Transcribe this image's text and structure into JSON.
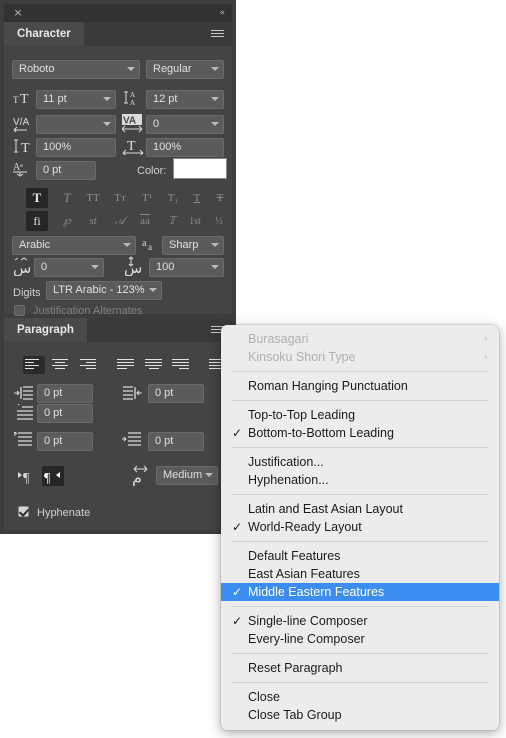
{
  "panel": {
    "close_icon": "×",
    "collapse_icon": "«",
    "character": {
      "tab_label": "Character",
      "menu_icon": "hamburger-icon",
      "font_family": "Roboto",
      "font_style": "Regular",
      "font_size_icon": "T",
      "font_size": "11 pt",
      "leading_icon": "leading-icon",
      "leading": "12 pt",
      "kerning_icon": "V/A",
      "kerning": "",
      "tracking_icon": "VA",
      "tracking": "0",
      "vertical_scale_icon": "vertical-scale-icon",
      "vertical_scale": "100%",
      "horizontal_scale_icon": "horizontal-scale-icon",
      "horizontal_scale": "100%",
      "baseline_shift_icon": "baseline-shift-icon",
      "baseline_shift": "0 pt",
      "color_label": "Color:",
      "color_value": "#ffffff",
      "style_buttons": [
        "T",
        "T",
        "TT",
        "Tт",
        "T¹",
        "T₁",
        "T",
        "T"
      ],
      "style_buttons_names": [
        "faux-bold",
        "faux-italic",
        "all-caps",
        "small-caps",
        "superscript",
        "subscript",
        "underline",
        "strikethrough"
      ],
      "opentype_buttons": [
        "fi",
        "℘",
        "st",
        "𝒜",
        "aa",
        "𝕋",
        "1st",
        "½"
      ],
      "opentype_names": [
        "standard-ligatures",
        "discretionary-ligatures",
        "swash",
        "stylistic-alternates",
        "titling-alternates",
        "ordinals",
        "fractions-1st",
        "fractions-half"
      ],
      "language": "Arabic",
      "antialias_icon": "aa",
      "antialias": "Sharp",
      "kashida_icon": "kashida-icon",
      "kashida": "0",
      "tatweel_icon": "tatweel-icon",
      "tatweel": "100",
      "digits_label": "Digits",
      "digits_value": "LTR Arabic - 123%",
      "justification_alternates": "Justification Alternates"
    },
    "paragraph": {
      "tab_label": "Paragraph",
      "menu_icon": "hamburger-icon",
      "align_buttons": [
        "align-left",
        "align-center",
        "align-right",
        "justify-last-left",
        "justify-last-center",
        "justify-last-right",
        "justify-all"
      ],
      "indent_left_icon": "indent-left-icon",
      "indent_left": "0 pt",
      "indent_right_icon": "indent-right-icon",
      "indent_right": "0 pt",
      "first_line_indent_icon": "first-line-indent-icon",
      "first_line_indent": "0 pt",
      "space_before_icon": "space-before-icon",
      "space_before": "0 pt",
      "space_after_icon": "space-after-icon",
      "space_after": "0 pt",
      "dir_ltr_icon": "paragraph-direction-ltr-icon",
      "dir_rtl_icon": "paragraph-direction-rtl-icon",
      "kashida_level_icon": "kashida-level-icon",
      "kashida_level": "Medium",
      "hyphenate_label": "Hyphenate",
      "hyphenate_checked": true
    }
  },
  "context_menu": {
    "items": [
      {
        "label": "Burasagari",
        "disabled": true,
        "checked": false,
        "submenu": true
      },
      {
        "label": "Kinsoku Shori Type",
        "disabled": true,
        "checked": false,
        "submenu": true
      },
      {
        "separator": true
      },
      {
        "label": "Roman Hanging Punctuation",
        "disabled": false,
        "checked": false,
        "submenu": false
      },
      {
        "separator": true
      },
      {
        "label": "Top-to-Top Leading",
        "disabled": false,
        "checked": false,
        "submenu": false
      },
      {
        "label": "Bottom-to-Bottom Leading",
        "disabled": false,
        "checked": true,
        "submenu": false
      },
      {
        "separator": true
      },
      {
        "label": "Justification...",
        "disabled": false,
        "checked": false,
        "submenu": false
      },
      {
        "label": "Hyphenation...",
        "disabled": false,
        "checked": false,
        "submenu": false
      },
      {
        "separator": true
      },
      {
        "label": "Latin and East Asian Layout",
        "disabled": false,
        "checked": false,
        "submenu": false
      },
      {
        "label": "World-Ready Layout",
        "disabled": false,
        "checked": true,
        "submenu": false
      },
      {
        "separator": true
      },
      {
        "label": "Default Features",
        "disabled": false,
        "checked": false,
        "submenu": false
      },
      {
        "label": "East Asian Features",
        "disabled": false,
        "checked": false,
        "submenu": false
      },
      {
        "label": "Middle Eastern Features",
        "disabled": false,
        "checked": true,
        "submenu": false,
        "highlighted": true
      },
      {
        "separator": true
      },
      {
        "label": "Single-line Composer",
        "disabled": false,
        "checked": true,
        "submenu": false
      },
      {
        "label": "Every-line Composer",
        "disabled": false,
        "checked": false,
        "submenu": false
      },
      {
        "separator": true
      },
      {
        "label": "Reset Paragraph",
        "disabled": false,
        "checked": false,
        "submenu": false
      },
      {
        "separator": true
      },
      {
        "label": "Close",
        "disabled": false,
        "checked": false,
        "submenu": false
      },
      {
        "label": "Close Tab Group",
        "disabled": false,
        "checked": false,
        "submenu": false
      }
    ],
    "checkmark_glyph": "✓",
    "submenu_glyph": "›",
    "highlight_color": "#3b8ef0"
  }
}
